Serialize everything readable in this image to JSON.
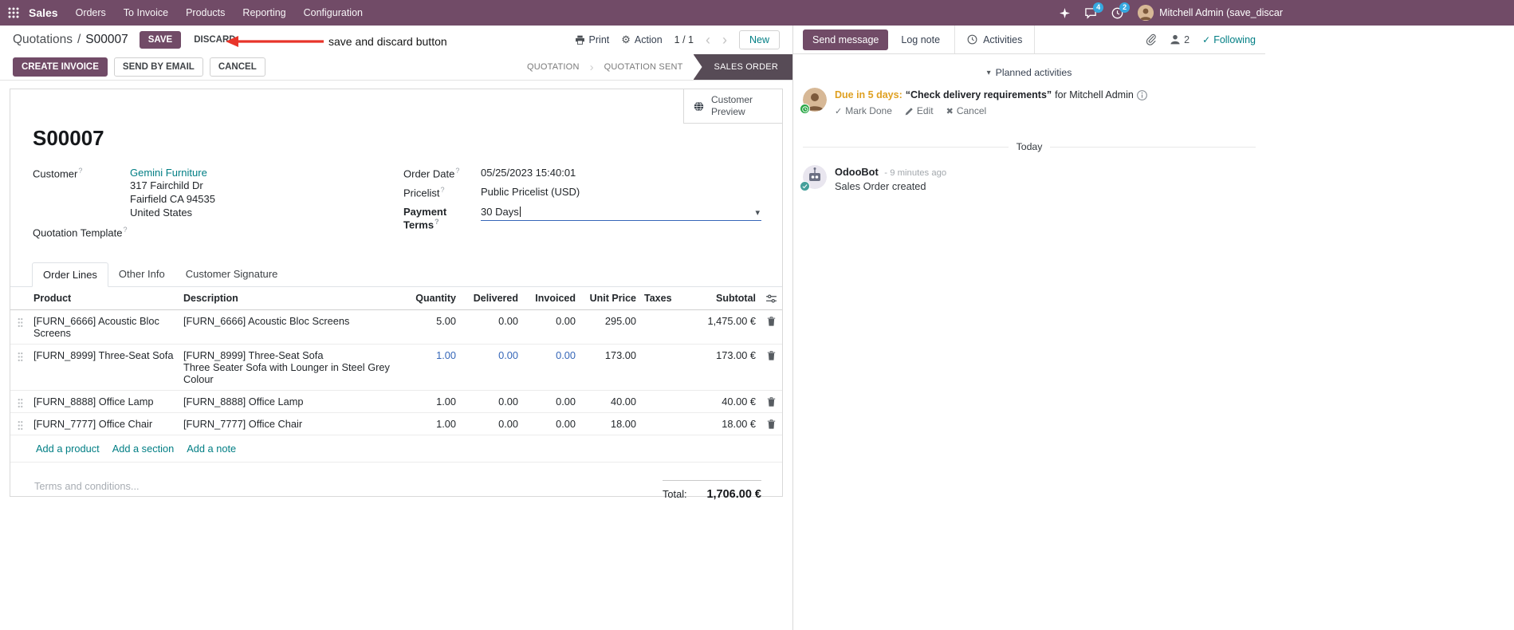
{
  "colors": {
    "primary": "#714B67",
    "link": "#017e84",
    "statusbar-active": "#574b56",
    "highlight": "#3566b8",
    "annotation": "#e8352a",
    "due": "#dfa021",
    "badge": "#36a8e0"
  },
  "icons": {
    "gear": "⚙",
    "pager_prev": "‹",
    "pager_next": "›",
    "caret_down": "▾",
    "section_caret": "▾",
    "check": "✓",
    "close": "✖",
    "chevron_sep": "›"
  },
  "navbar": {
    "app_name": "Sales",
    "menus": [
      "Orders",
      "To Invoice",
      "Products",
      "Reporting",
      "Configuration"
    ],
    "messages_badge": "4",
    "activities_badge": "2",
    "user_name": "Mitchell Admin (save_discar"
  },
  "breadcrumb": {
    "parent": "Quotations",
    "separator": "/",
    "current": "S00007",
    "save_label": "SAVE",
    "discard_label": "DISCARD",
    "print_label": "Print",
    "action_label": "Action",
    "pager": "1 / 1",
    "new_label": "New"
  },
  "annotation": {
    "text": "save and discard button"
  },
  "actions": {
    "create_invoice": "CREATE INVOICE",
    "send_by_email": "SEND BY EMAIL",
    "cancel": "CANCEL"
  },
  "statusbar": {
    "steps": [
      {
        "label": "QUOTATION",
        "active": false
      },
      {
        "label": "QUOTATION SENT",
        "active": false
      },
      {
        "label": "SALES ORDER",
        "active": true
      }
    ]
  },
  "form": {
    "customer_preview": "Customer Preview",
    "title": "S00007",
    "help_marker": "?",
    "customer_label": "Customer",
    "customer_name": "Gemini Furniture",
    "address_line1": "317 Fairchild Dr",
    "address_line2": "Fairfield CA 94535",
    "address_line3": "United States",
    "quotation_template_label": "Quotation Template",
    "order_date_label": "Order Date",
    "order_date": "05/25/2023 15:40:01",
    "pricelist_label": "Pricelist",
    "pricelist": "Public Pricelist (USD)",
    "payment_terms_label": "Payment Terms",
    "payment_terms": "30 Days",
    "tabs": [
      "Order Lines",
      "Other Info",
      "Customer Signature"
    ],
    "table": {
      "headers": [
        "Product",
        "Description",
        "Quantity",
        "Delivered",
        "Invoiced",
        "Unit Price",
        "Taxes",
        "Subtotal"
      ],
      "rows": [
        {
          "product": "[FURN_6666] Acoustic Bloc Screens",
          "description": "[FURN_6666] Acoustic Bloc Screens",
          "description2": "",
          "quantity": "5.00",
          "delivered": "0.00",
          "invoiced": "0.00",
          "unit_price": "295.00",
          "taxes": "",
          "subtotal": "1,475.00 €"
        },
        {
          "product": "[FURN_8999] Three-Seat Sofa",
          "description": "[FURN_8999] Three-Seat Sofa",
          "description2": "Three Seater Sofa with Lounger in Steel Grey Colour",
          "quantity": "1.00",
          "delivered": "0.00",
          "invoiced": "0.00",
          "unit_price": "173.00",
          "taxes": "",
          "subtotal": "173.00 €"
        },
        {
          "product": "[FURN_8888] Office Lamp",
          "description": "[FURN_8888] Office Lamp",
          "description2": "",
          "quantity": "1.00",
          "delivered": "0.00",
          "invoiced": "0.00",
          "unit_price": "40.00",
          "taxes": "",
          "subtotal": "40.00 €"
        },
        {
          "product": "[FURN_7777] Office Chair",
          "description": "[FURN_7777] Office Chair",
          "description2": "",
          "quantity": "1.00",
          "delivered": "0.00",
          "invoiced": "0.00",
          "unit_price": "18.00",
          "taxes": "",
          "subtotal": "18.00 €"
        }
      ]
    },
    "add_product": "Add a product",
    "add_section": "Add a section",
    "add_note": "Add a note",
    "terms_placeholder": "Terms and conditions...",
    "total_label": "Total:",
    "total_value": "1,706.00 €"
  },
  "chatter": {
    "send_message": "Send message",
    "log_note": "Log note",
    "activities_tab": "Activities",
    "followers_count": "2",
    "following": "Following",
    "planned_activities": "Planned activities",
    "activity": {
      "due": "Due in 5 days:",
      "summary": "“Check delivery requirements”",
      "for_text": "for Mitchell Admin",
      "mark_done": "Mark Done",
      "edit": "Edit",
      "cancel": "Cancel"
    },
    "today": "Today",
    "message": {
      "author": "OdooBot",
      "time": "- 9 minutes ago",
      "body": "Sales Order created"
    }
  }
}
